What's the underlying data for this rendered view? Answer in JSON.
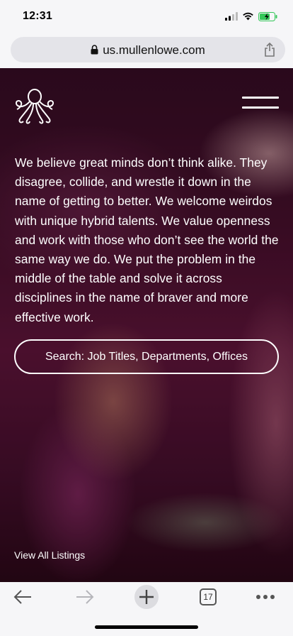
{
  "status_bar": {
    "time": "12:31"
  },
  "browser": {
    "url": "us.mullenlowe.com",
    "tabs_count": "17"
  },
  "page": {
    "intro": "We believe great minds don’t think alike. They disagree, collide, and wrestle it down in the name of getting to better. We welcome weirdos with unique hybrid talents. We value openness and work with those who don’t see the world the same way we do. We put the problem in the middle of the table and solve it across disciplines in the name of braver and more effective work.",
    "search_placeholder": "Search: Job Titles, Departments, Offices",
    "view_all": "View All Listings"
  },
  "colors": {
    "accent": "#5a1538",
    "battery_green": "#34c759"
  },
  "icons": [
    "signal-icon",
    "wifi-icon",
    "battery-icon",
    "lock-icon",
    "share-icon",
    "octopus-logo",
    "menu-icon",
    "back-icon",
    "forward-icon",
    "new-tab-icon",
    "tabs-icon",
    "more-icon"
  ]
}
